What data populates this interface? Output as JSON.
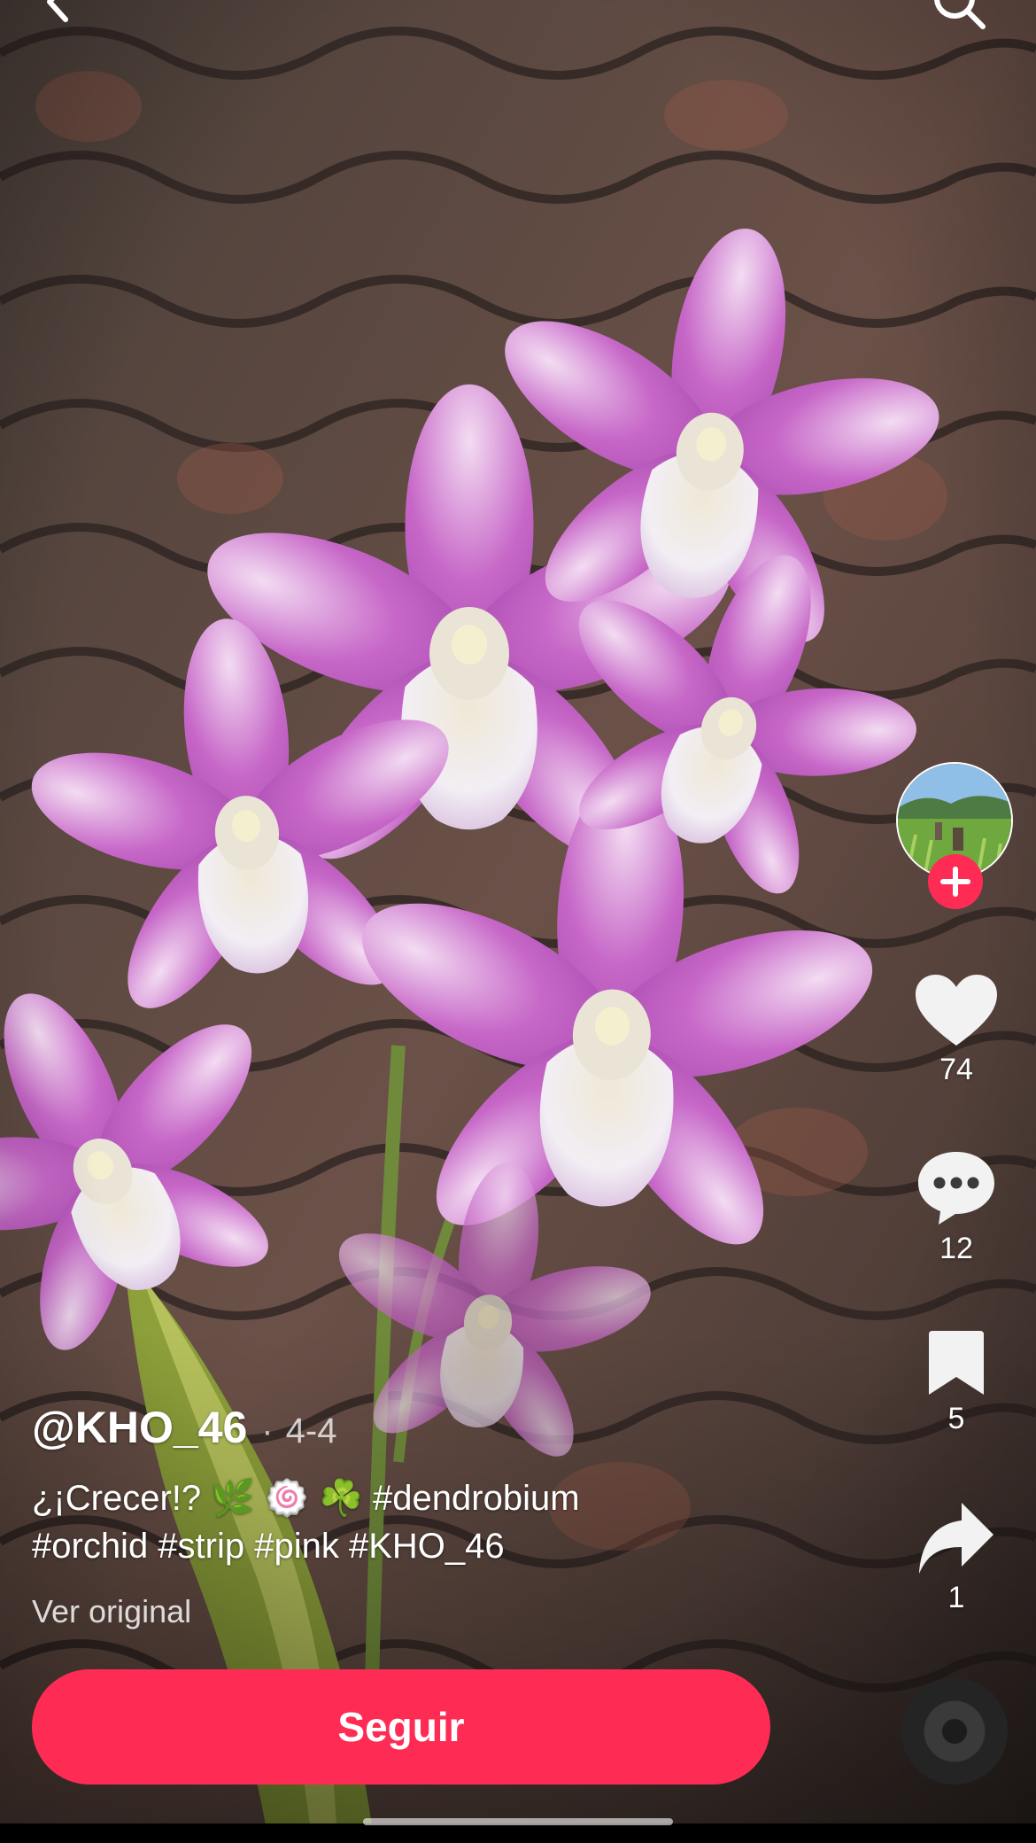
{
  "post": {
    "username": "@KHO_46",
    "separator": "·",
    "date": "4-4",
    "caption_text": "¿¡Crecer!? ",
    "caption_emojis": [
      "🌿",
      "🍥",
      "☘️"
    ],
    "hashtags_line1": " #dendrobium",
    "hashtags_line2": "#orchid #strip #pink #KHO_46",
    "see_original": "Ver original"
  },
  "actions": {
    "likes": "74",
    "comments": "12",
    "saves": "5",
    "shares": "1"
  },
  "follow_button": {
    "label": "Seguir"
  },
  "icons": {
    "back": "chevron-left-icon",
    "search": "search-icon",
    "follow": "plus-icon",
    "like": "heart-icon",
    "comment": "comment-bubble-icon",
    "save": "bookmark-icon",
    "share": "share-arrow-icon",
    "music": "music-disc-icon"
  },
  "colors": {
    "accent": "#fe2c55",
    "text": "#ffffff",
    "flower": "#c768c8"
  }
}
